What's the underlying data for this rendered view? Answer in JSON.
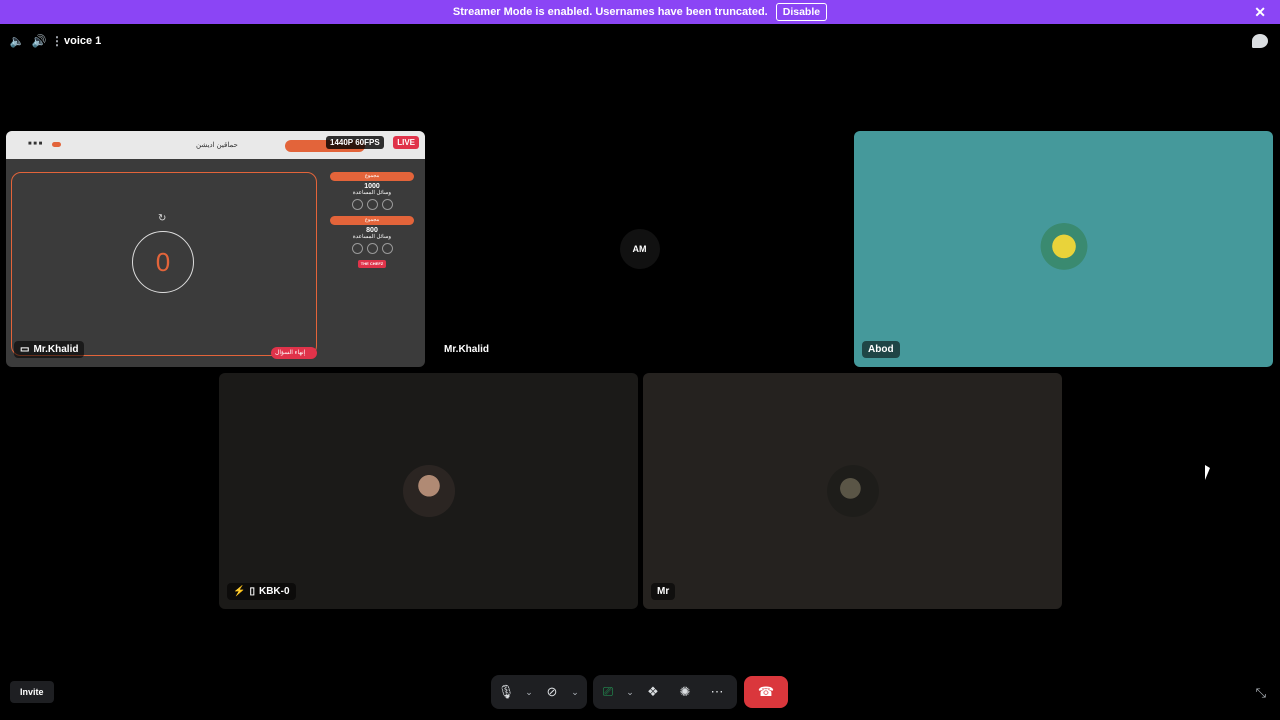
{
  "banner": {
    "message": "Streamer Mode is enabled. Usernames have been truncated.",
    "disable_label": "Disable",
    "close": "✕"
  },
  "channel": {
    "name": "voice 1"
  },
  "tiles": {
    "stream": {
      "username": "Mr.Khalid",
      "resolution": "1440P 60FPS",
      "live": "LIVE",
      "header_title": "حماقين اديشن",
      "timer_value": "0",
      "side": [
        {
          "bar": "مجموع",
          "value": "1000",
          "sub": "وسائل المساعدة"
        },
        {
          "bar": "مجموع",
          "value": "800",
          "sub": "وسائل المساعدة"
        }
      ],
      "logo": "THE CHEFZ",
      "exit": "إنهاء السؤال"
    },
    "mrk": {
      "username": "Mr.Khalid",
      "avatar_text": "AM"
    },
    "abod": {
      "username": "Abod"
    },
    "kbk": {
      "username": "KBK-0"
    },
    "mr": {
      "username": "Mr"
    }
  },
  "footer": {
    "invite": "Invite"
  }
}
